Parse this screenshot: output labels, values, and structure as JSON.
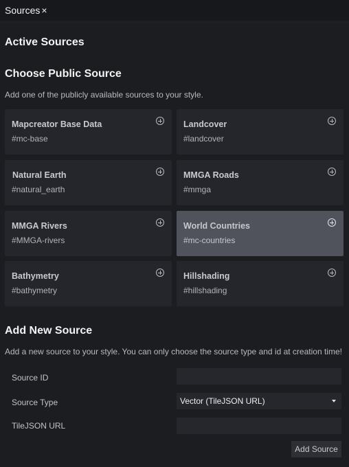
{
  "tab": {
    "title": "Sources",
    "close_glyph": "×"
  },
  "active_sources": {
    "heading": "Active Sources"
  },
  "public_sources": {
    "heading": "Choose Public Source",
    "description": "Add one of the publicly available sources to your style.",
    "items": [
      {
        "title": "Mapcreator Base Data",
        "id": "#mc-base",
        "highlighted": false
      },
      {
        "title": "Landcover",
        "id": "#landcover",
        "highlighted": false
      },
      {
        "title": "Natural Earth",
        "id": "#natural_earth",
        "highlighted": false
      },
      {
        "title": "MMGA Roads",
        "id": "#mmga",
        "highlighted": false
      },
      {
        "title": "MMGA Rivers",
        "id": "#MMGA-rivers",
        "highlighted": false
      },
      {
        "title": "World Countries",
        "id": "#mc-countries",
        "highlighted": true
      },
      {
        "title": "Bathymetry",
        "id": "#bathymetry",
        "highlighted": false
      },
      {
        "title": "Hillshading",
        "id": "#hillshading",
        "highlighted": false
      }
    ]
  },
  "new_source": {
    "heading": "Add New Source",
    "description": "Add a new source to your style. You can only choose the source type and id at creation time!",
    "source_id_label": "Source ID",
    "source_id_value": "",
    "source_type_label": "Source Type",
    "source_type_value": "Vector (TileJSON URL)",
    "tilejson_label": "TileJSON URL",
    "tilejson_value": "",
    "add_button": "Add Source"
  },
  "colors": {
    "background": "#1c1d21",
    "card": "#25262b",
    "card_highlight": "#50525c"
  },
  "icons": {
    "add": "plus-circle-icon",
    "close": "close-icon",
    "dropdown": "caret-down-icon"
  }
}
